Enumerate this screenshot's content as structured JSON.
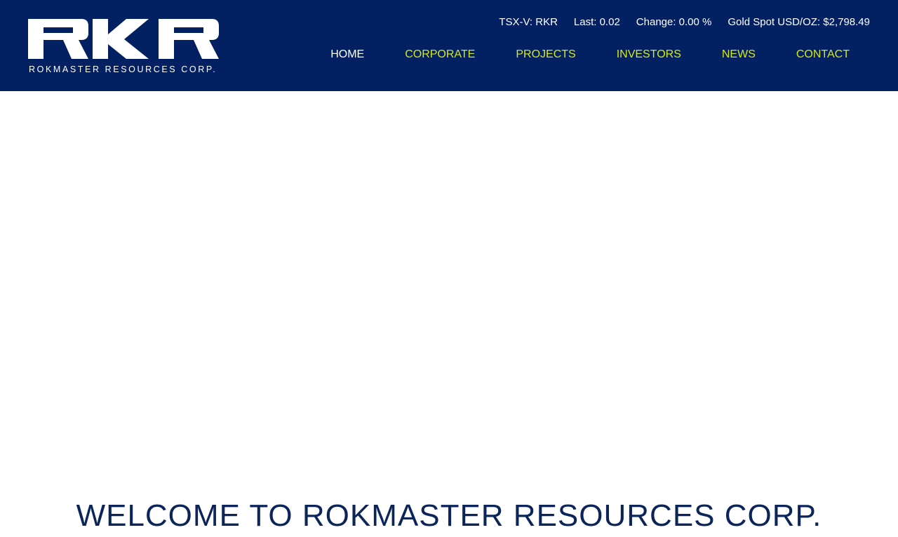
{
  "brand": {
    "logo_text": "RKR",
    "tagline": "ROKMASTER RESOURCES CORP."
  },
  "ticker": {
    "symbol": "TSX-V: RKR",
    "last": "Last: 0.02",
    "change": "Change: 0.00 %",
    "gold_spot": "Gold Spot USD/OZ: $2,798.49"
  },
  "nav": {
    "items": [
      {
        "label": "HOME",
        "active": true
      },
      {
        "label": "CORPORATE",
        "active": false
      },
      {
        "label": "PROJECTS",
        "active": false
      },
      {
        "label": "INVESTORS",
        "active": false
      },
      {
        "label": "NEWS",
        "active": false
      },
      {
        "label": "CONTACT",
        "active": false
      }
    ]
  },
  "main": {
    "heading": "WELCOME TO ROKMASTER RESOURCES CORP."
  },
  "colors": {
    "header_bg": "#022062",
    "nav_accent": "#d4e81f",
    "heading_text": "#0b2459"
  }
}
